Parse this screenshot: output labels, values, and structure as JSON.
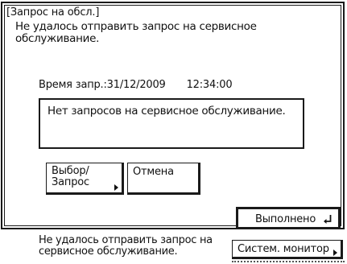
{
  "dialog": {
    "title": "[Запрос на обсл.]",
    "message": "Не удалось отправить запрос на сервисное обслуживание.",
    "request_time_label": "Время запр.:31/12/2009",
    "request_time_clock": "12:34:00",
    "requests_text": "Нет запросов на сервисное обслуживание.",
    "select_request_label": "Выбор/\nЗапрос",
    "cancel_label": "Отмена",
    "done_label": "Выполнено"
  },
  "status_bar": {
    "message": "Не удалось отправить запрос на сервисное обслуживание.",
    "system_monitor_label": "Систем. монитор"
  },
  "icons": {
    "arrow": "arrow-right-icon",
    "enter": "enter-return-icon"
  }
}
